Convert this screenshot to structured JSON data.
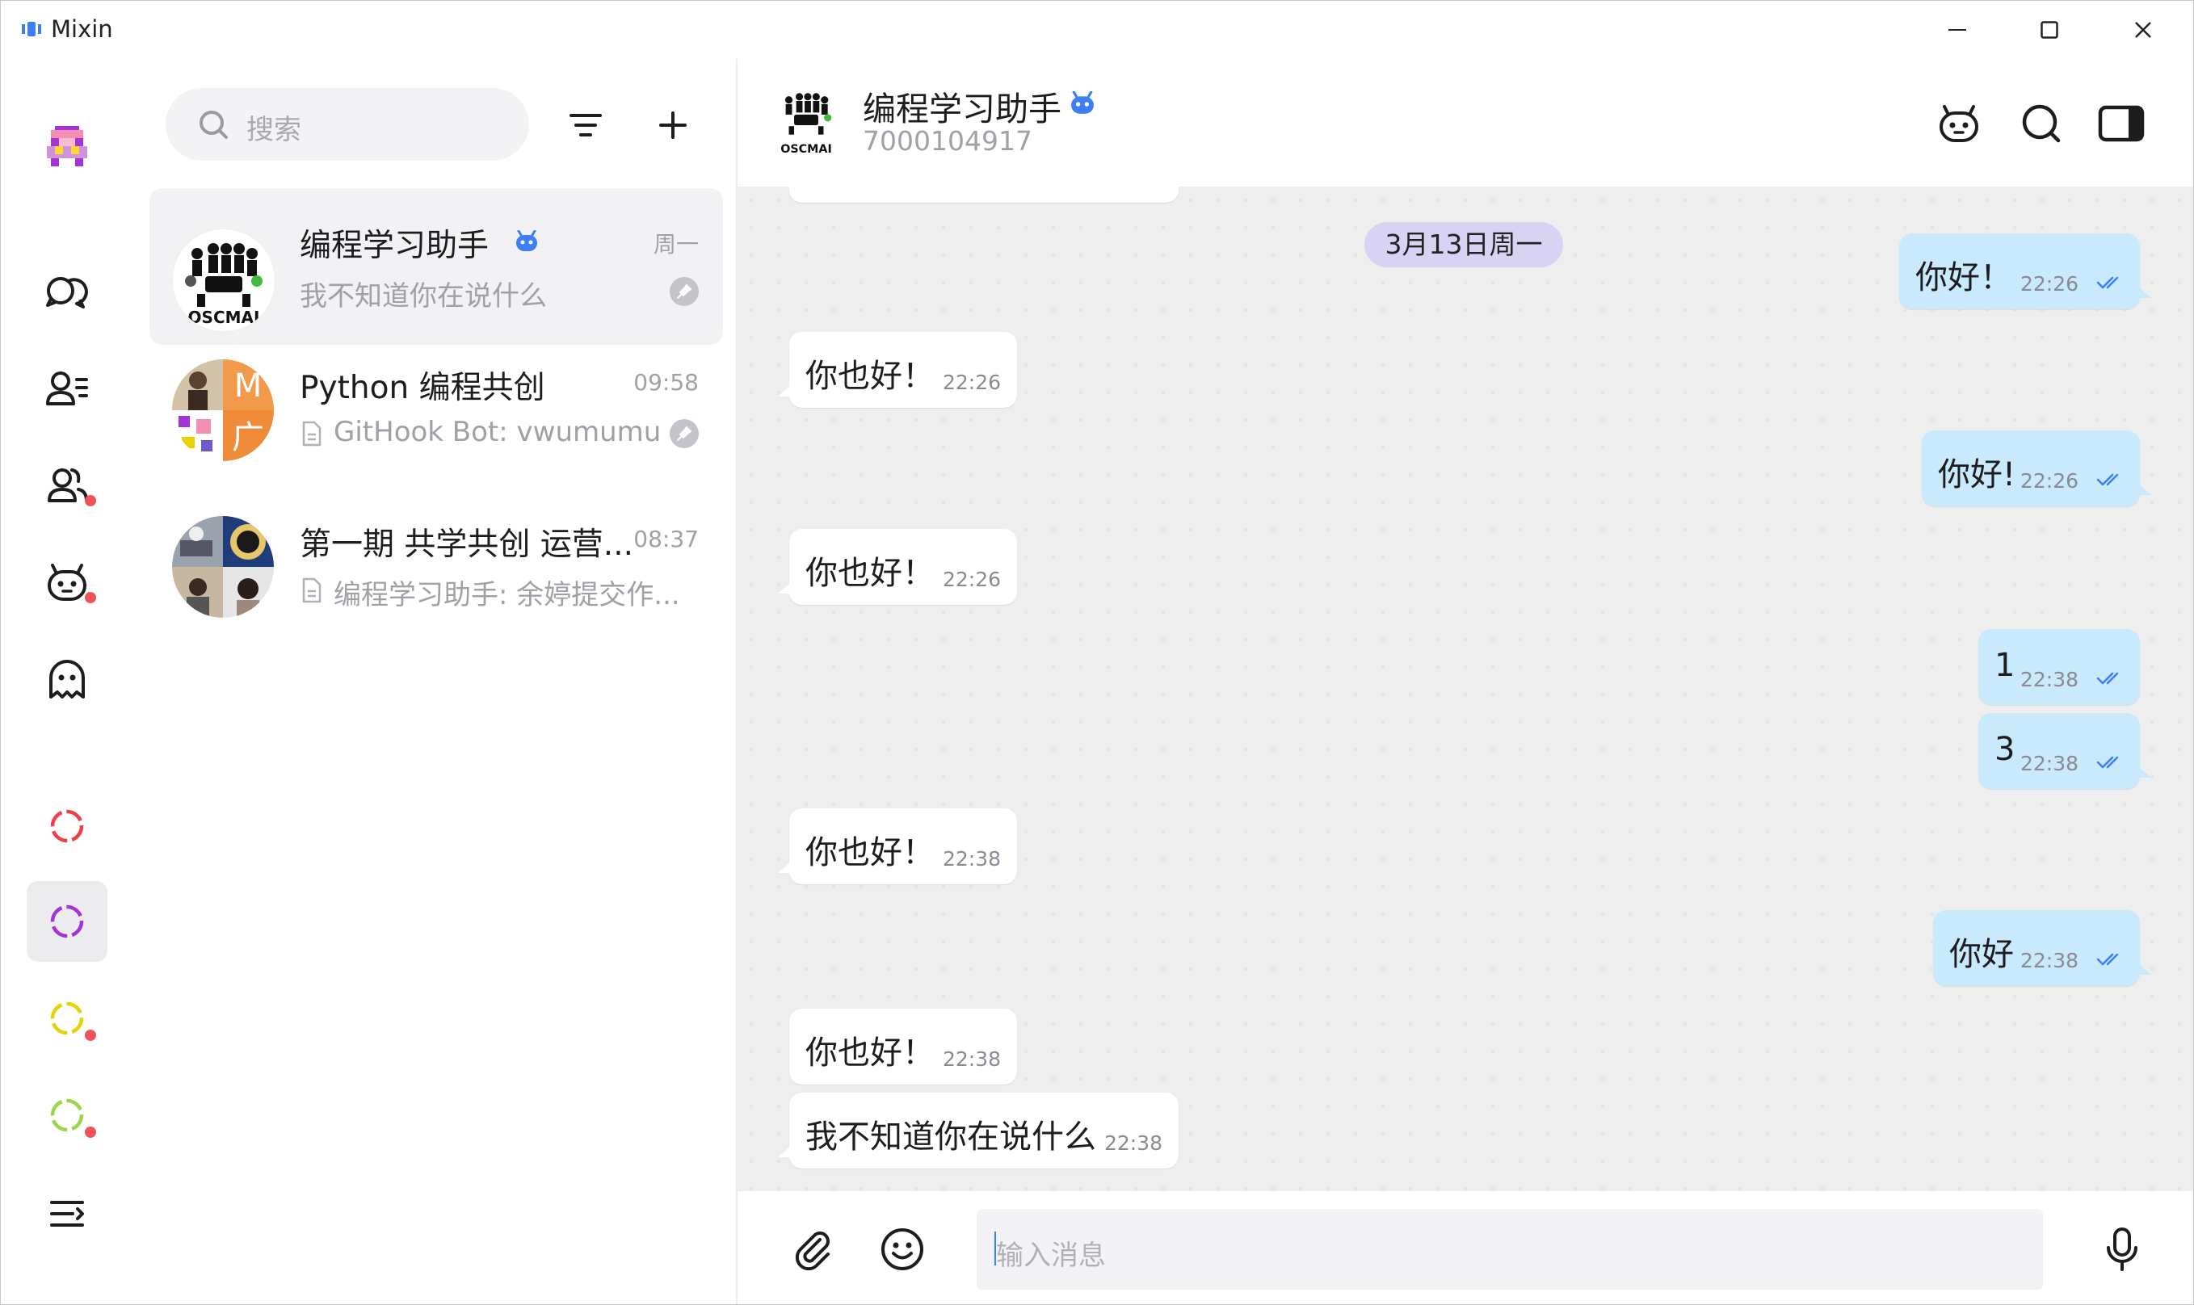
{
  "window": {
    "title": "Mixin",
    "minimize_icon": "minimize-icon",
    "maximize_icon": "maximize-icon",
    "close_icon": "close-icon"
  },
  "sidebar": {
    "items": [
      {
        "name": "my-avatar",
        "icon": "pixel-avatar"
      },
      {
        "name": "chats",
        "icon": "chat-bubbles-icon"
      },
      {
        "name": "contacts",
        "icon": "contacts-icon"
      },
      {
        "name": "groups",
        "icon": "group-icon",
        "badge": true
      },
      {
        "name": "bots",
        "icon": "bot-icon",
        "badge": true
      },
      {
        "name": "strangers",
        "icon": "ghost-icon"
      },
      {
        "name": "circle-red",
        "icon": "circle-icon",
        "color": "#ee3f4d"
      },
      {
        "name": "circle-purple",
        "icon": "circle-icon",
        "color": "#a433d8",
        "active": true
      },
      {
        "name": "circle-yellow",
        "icon": "circle-icon",
        "color": "#e8d200",
        "badge": true
      },
      {
        "name": "circle-green",
        "icon": "circle-icon",
        "color": "#9bd64a",
        "badge": true
      },
      {
        "name": "collapse",
        "icon": "collapse-menu-icon"
      }
    ]
  },
  "search": {
    "placeholder": "搜索"
  },
  "conversations": [
    {
      "name": "编程学习助手",
      "verified": true,
      "time": "周一",
      "preview": "我不知道你在说什么",
      "pinned": true,
      "selected": true
    },
    {
      "name": "Python 编程共创",
      "time": "09:58",
      "preview": "GitHook Bot: vwumumu ...",
      "pinned": true,
      "file_icon": true
    },
    {
      "name": "第一期 共学共创 运营...",
      "time": "08:37",
      "preview": "编程学习助手: 余婷提交作...",
      "file_icon": true
    }
  ],
  "chat": {
    "title": "编程学习助手",
    "id": "7000104917",
    "date_separator": "3月13日周一",
    "messages": [
      {
        "dir": "out",
        "text": "你好！",
        "time": "22:26",
        "read": true
      },
      {
        "dir": "in",
        "text": "你也好！",
        "time": "22:26"
      },
      {
        "dir": "out",
        "text": "你好!",
        "time": "22:26",
        "read": true
      },
      {
        "dir": "in",
        "text": "你也好！",
        "time": "22:26"
      },
      {
        "dir": "out",
        "text": "1",
        "time": "22:38",
        "read": true
      },
      {
        "dir": "out",
        "text": "3",
        "time": "22:38",
        "read": true
      },
      {
        "dir": "in",
        "text": "你也好！",
        "time": "22:38"
      },
      {
        "dir": "out",
        "text": "你好",
        "time": "22:38",
        "read": true
      },
      {
        "dir": "in",
        "text": "你也好！",
        "time": "22:38"
      },
      {
        "dir": "in",
        "text": "我不知道你在说什么",
        "time": "22:38"
      }
    ]
  },
  "composer": {
    "placeholder": "输入消息"
  },
  "colors": {
    "accent": "#3d7ef5",
    "outgoing_bubble": "#c9e9fd",
    "date_pill": "#d8d3f2"
  }
}
